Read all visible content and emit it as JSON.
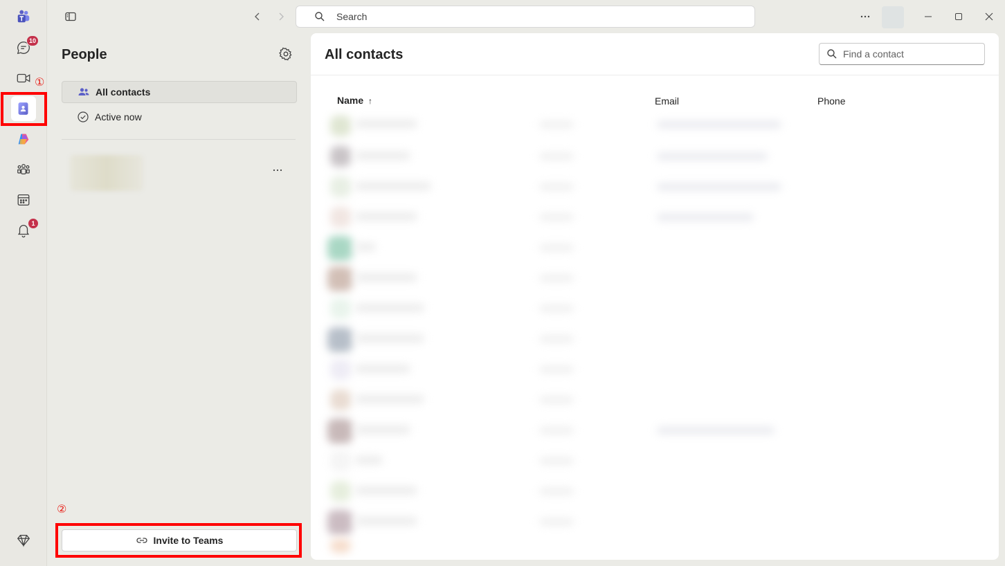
{
  "rail": {
    "chat_badge": "10",
    "activity_badge": "1",
    "annotation_1": "①",
    "annotation_2": "②"
  },
  "titlebar": {
    "search_placeholder": "Search"
  },
  "left_pane": {
    "title": "People",
    "nav": [
      {
        "label": "All contacts",
        "selected": true
      },
      {
        "label": "Active now",
        "selected": false
      }
    ],
    "invite_label": "Invite to Teams"
  },
  "main": {
    "title": "All contacts",
    "find_placeholder": "Find a contact",
    "columns": {
      "name": "Name",
      "email": "Email",
      "phone": "Phone"
    }
  },
  "colors": {
    "accent": "#5b5fc7",
    "highlight": "#ff0000",
    "badge": "#c4314b"
  }
}
